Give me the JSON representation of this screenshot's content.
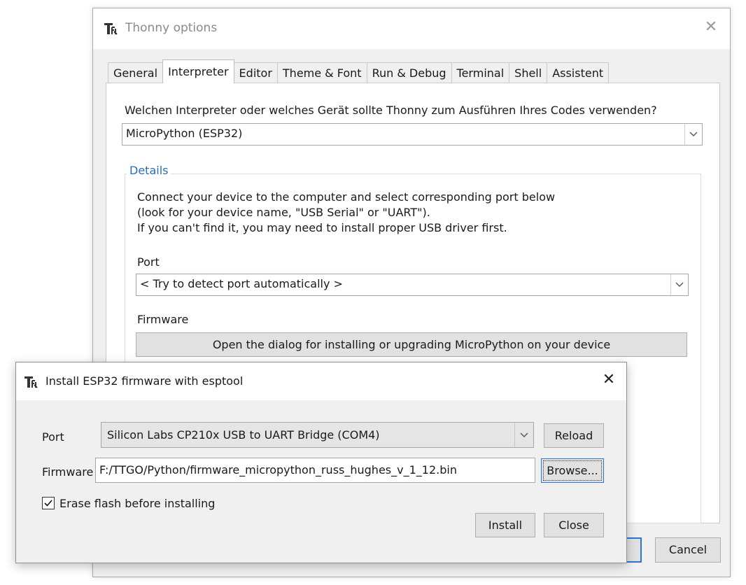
{
  "options_window": {
    "title": "Thonny options",
    "tabs": [
      {
        "label": "General"
      },
      {
        "label": "Interpreter",
        "active": true
      },
      {
        "label": "Editor"
      },
      {
        "label": "Theme & Font"
      },
      {
        "label": "Run & Debug"
      },
      {
        "label": "Terminal"
      },
      {
        "label": "Shell"
      },
      {
        "label": "Assistent"
      }
    ],
    "interpreter_question": "Welchen Interpreter oder welches Gerät sollte Thonny zum Ausführen Ihres Codes verwenden?",
    "interpreter_value": "MicroPython (ESP32)",
    "details": {
      "legend": "Details",
      "line1": "Connect your device to the computer and select corresponding port below",
      "line2": "(look for your device name, \"USB Serial\" or \"UART\").",
      "line3": "If you can't find it, you may need to install proper USB driver first.",
      "port_label": "Port",
      "port_value": "< Try to detect port automatically >",
      "firmware_label": "Firmware",
      "firmware_button": "Open the dialog for installing or upgrading MicroPython on your device"
    },
    "cancel_label": "Cancel"
  },
  "esp_dialog": {
    "title": "Install ESP32 firmware with esptool",
    "port_label": "Port",
    "port_value": "Silicon Labs CP210x USB to UART Bridge (COM4)",
    "reload_label": "Reload",
    "firmware_label": "Firmware",
    "firmware_path": "F:/TTGO/Python/firmware_micropython_russ_hughes_v_1_12.bin",
    "browse_label": "Browse...",
    "erase_label": "Erase flash before installing",
    "erase_checked": true,
    "install_label": "Install",
    "close_label": "Close"
  },
  "colors": {
    "accent": "#2a78d4",
    "legend": "#2a6db5"
  },
  "icons": [
    "thonny-logo-icon",
    "close-icon",
    "chevron-down-icon",
    "checkmark-icon"
  ]
}
